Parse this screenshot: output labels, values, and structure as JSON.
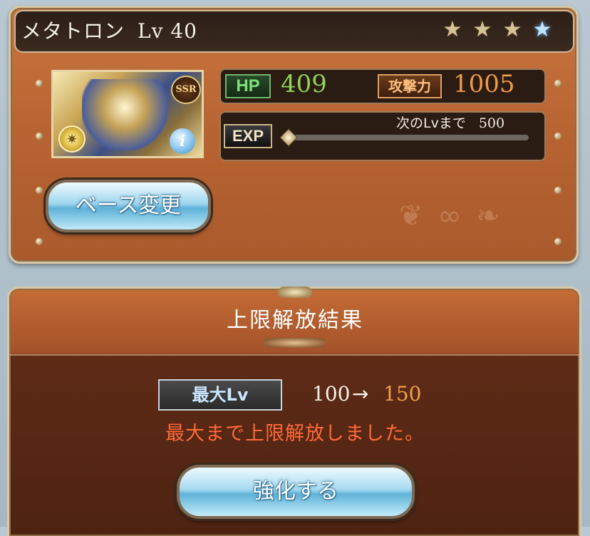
{
  "character": {
    "name": "メタトロン",
    "level_text": "Lv 40",
    "rarity": "SSR",
    "stars": {
      "filled": 3,
      "blue": 1
    },
    "hp_label": "HP",
    "hp_value": "409",
    "atk_label": "攻撃力",
    "atk_value": "1005",
    "exp_label": "EXP",
    "next_lv_label": "次のLvまで",
    "next_lv_value": "500",
    "exp_fraction": 0.0,
    "base_change_label": "ベース変更"
  },
  "result": {
    "title": "上限解放結果",
    "max_lv_label": "最大Lv",
    "old_max": "100",
    "arrow": "→",
    "new_max": "150",
    "message": "最大まで上限解放しました。",
    "enhance_label": "強化する"
  },
  "colors": {
    "panel": "#b86332",
    "hp": "#8fd45a",
    "atk": "#f29a45",
    "new_level": "#f0a24a",
    "message": "#ff6a3a",
    "button": "#9fd6ee"
  }
}
